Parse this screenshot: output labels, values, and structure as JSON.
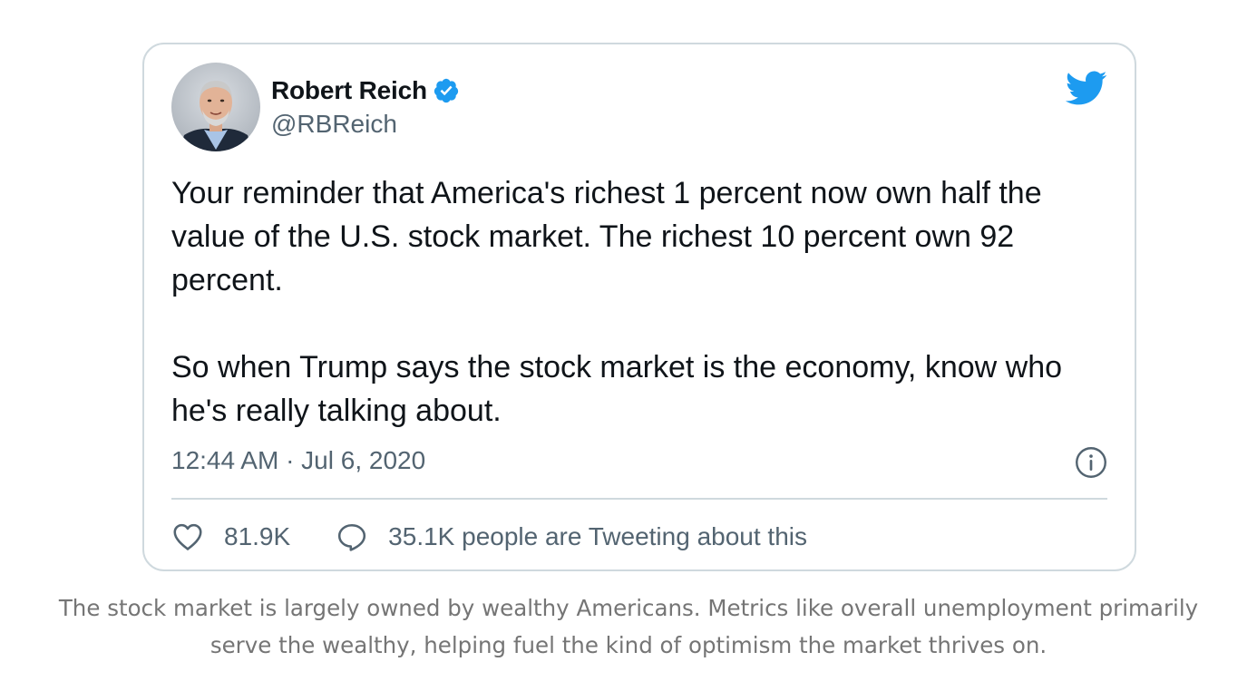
{
  "tweet": {
    "display_name": "Robert Reich",
    "handle": "@RBReich",
    "verified": true,
    "paragraphs": [
      "Your reminder that America's richest 1 percent now own half the value of the U.S. stock market. The richest 10 percent own 92 percent.",
      "So when Trump says the stock market is the economy, know who he's really talking about."
    ],
    "timestamp": "12:44 AM · Jul 6, 2020",
    "likes": "81.9K",
    "conversation": "35.1K people are Tweeting about this"
  },
  "caption": {
    "line1": "The stock market is largely owned by wealthy Americans. Metrics like overall unemployment primarily",
    "line2": "serve the wealthy, helping fuel the kind of optimism the market thrives on."
  },
  "colors": {
    "twitter_blue": "#1d9bf0",
    "text_primary": "#0f1419",
    "text_secondary": "#536471",
    "border": "#cfd9de",
    "caption": "#757575"
  },
  "icons": {
    "logo": "twitter-bird-icon",
    "verified": "verified-badge-icon",
    "info": "info-icon",
    "like": "heart-icon",
    "reply": "speech-bubble-icon"
  }
}
